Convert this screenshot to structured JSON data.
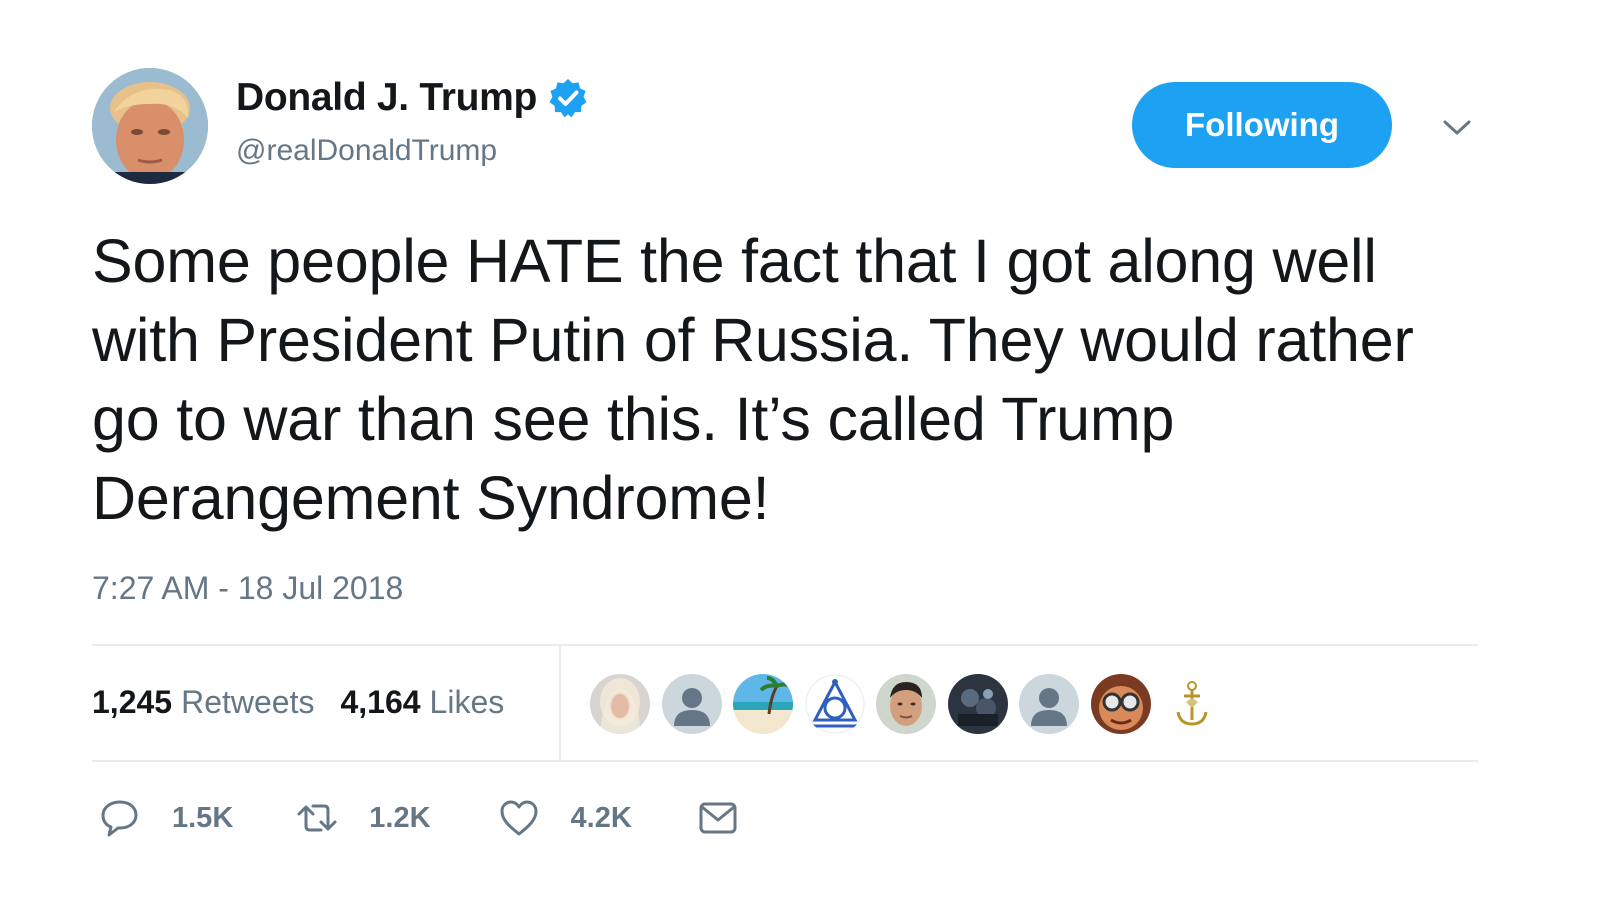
{
  "author": {
    "display_name": "Donald J. Trump",
    "handle": "@realDonaldTrump",
    "verified": true,
    "avatar_icon": "profile-photo"
  },
  "follow_button": {
    "label": "Following"
  },
  "menu": {
    "icon": "chevron-down-icon"
  },
  "tweet": {
    "text": "Some people HATE the fact that I got along well with President Putin of Russia. They would rather go to war than see this. It’s called Trump Derangement Syndrome!",
    "timestamp": "7:27 AM - 18 Jul 2018"
  },
  "stats": {
    "retweets_count": "1,245",
    "retweets_label": "Retweets",
    "likes_count": "4,164",
    "likes_label": "Likes"
  },
  "likers": [
    {
      "icon": "liker-avatar-blonde-woman"
    },
    {
      "icon": "liker-avatar-default"
    },
    {
      "icon": "liker-avatar-beach"
    },
    {
      "icon": "liker-avatar-blue-symbol"
    },
    {
      "icon": "liker-avatar-man"
    },
    {
      "icon": "liker-avatar-dark-photo"
    },
    {
      "icon": "liker-avatar-default"
    },
    {
      "icon": "liker-avatar-goggles"
    },
    {
      "icon": "liker-avatar-anchor-emblem"
    }
  ],
  "actions": {
    "reply_count": "1.5K",
    "retweet_count": "1.2K",
    "like_count": "4.2K"
  },
  "colors": {
    "accent": "#1da1f2",
    "text": "#14171a",
    "secondary_text": "#657786",
    "divider": "#e6ecf0"
  }
}
